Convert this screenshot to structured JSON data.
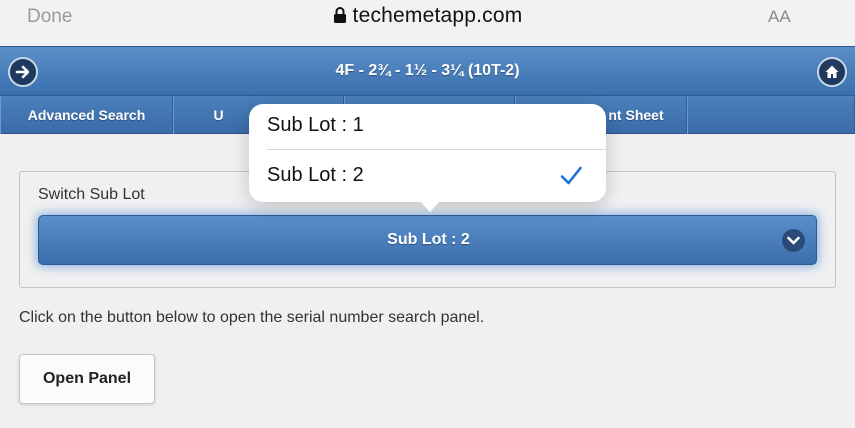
{
  "safari": {
    "done_label": "Done",
    "url": "techemetapp.com",
    "text_size_label": "AA"
  },
  "header": {
    "title": "4F - 2¾ - 1½ - 3¼ (10T-2)"
  },
  "tabs": [
    {
      "label": "Advanced Search"
    },
    {
      "label": "U"
    },
    {
      "label": ""
    },
    {
      "label": "nt Sheet"
    },
    {
      "label": ""
    }
  ],
  "sublot": {
    "legend": "Switch Sub Lot",
    "selected": "Sub Lot : 2",
    "options": [
      {
        "label": "Sub Lot : 1",
        "checked": false
      },
      {
        "label": "Sub Lot : 2",
        "checked": true
      }
    ]
  },
  "instructions": "Click on the button below to open the serial number search panel.",
  "open_panel_label": "Open Panel",
  "colors": {
    "accent": "#3b6eac",
    "check": "#1a73d9"
  }
}
